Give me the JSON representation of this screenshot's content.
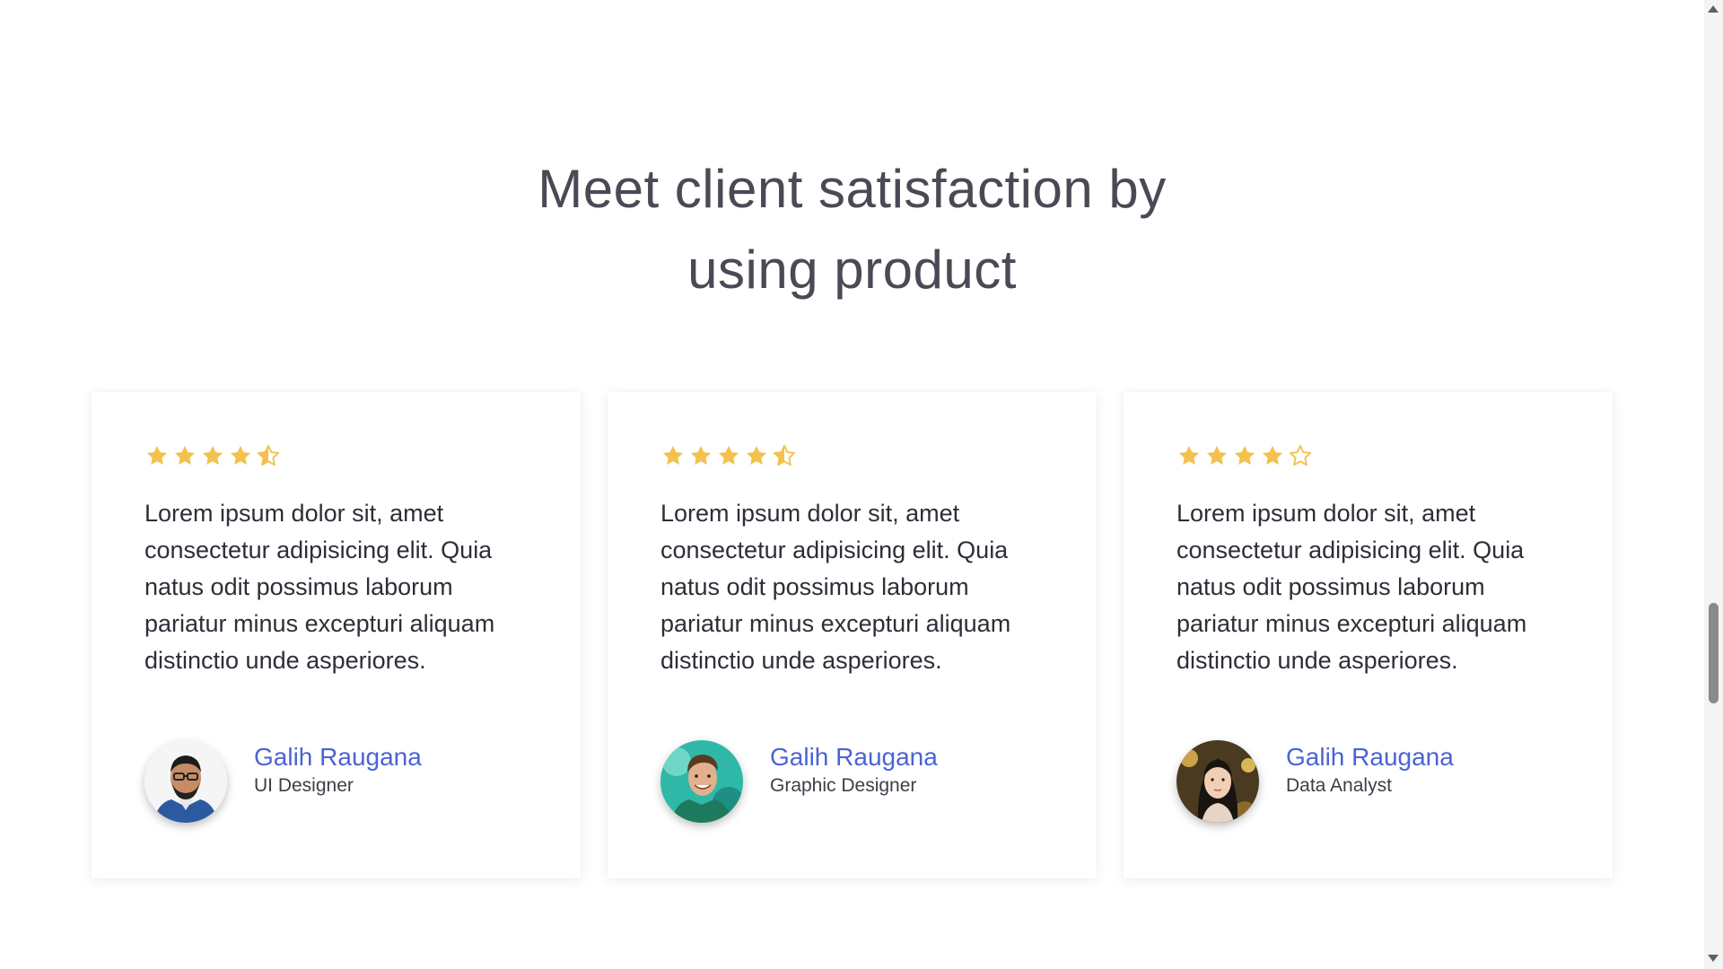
{
  "section": {
    "title_line1": "Meet client satisfaction by",
    "title_line2": "using product"
  },
  "colors": {
    "star": "#f2c14e",
    "author_name": "#4b63d4",
    "title": "#4a4a55"
  },
  "testimonials": [
    {
      "rating": 4.5,
      "rating_icons": [
        "star-full-icon",
        "star-full-icon",
        "star-full-icon",
        "star-full-icon",
        "star-half-icon"
      ],
      "quote": "Lorem ipsum dolor sit, amet consectetur adipisicing elit. Quia natus odit possimus laborum pariatur minus excepturi aliquam distinctio unde asperiores.",
      "name": "Galih Raugana",
      "role": "UI Designer",
      "avatar_icon": "avatar-man-glasses"
    },
    {
      "rating": 4.5,
      "rating_icons": [
        "star-full-icon",
        "star-full-icon",
        "star-full-icon",
        "star-full-icon",
        "star-half-icon"
      ],
      "quote": "Lorem ipsum dolor sit, amet consectetur adipisicing elit. Quia natus odit possimus laborum pariatur minus excepturi aliquam distinctio unde asperiores.",
      "name": "Galih Raugana",
      "role": "Graphic Designer",
      "avatar_icon": "avatar-man-smiling"
    },
    {
      "rating": 4,
      "rating_icons": [
        "star-full-icon",
        "star-full-icon",
        "star-full-icon",
        "star-full-icon",
        "star-empty-icon"
      ],
      "quote": "Lorem ipsum dolor sit, amet consectetur adipisicing elit. Quia natus odit possimus laborum pariatur minus excepturi aliquam distinctio unde asperiores.",
      "name": "Galih Raugana",
      "role": "Data Analyst",
      "avatar_icon": "avatar-woman"
    }
  ]
}
